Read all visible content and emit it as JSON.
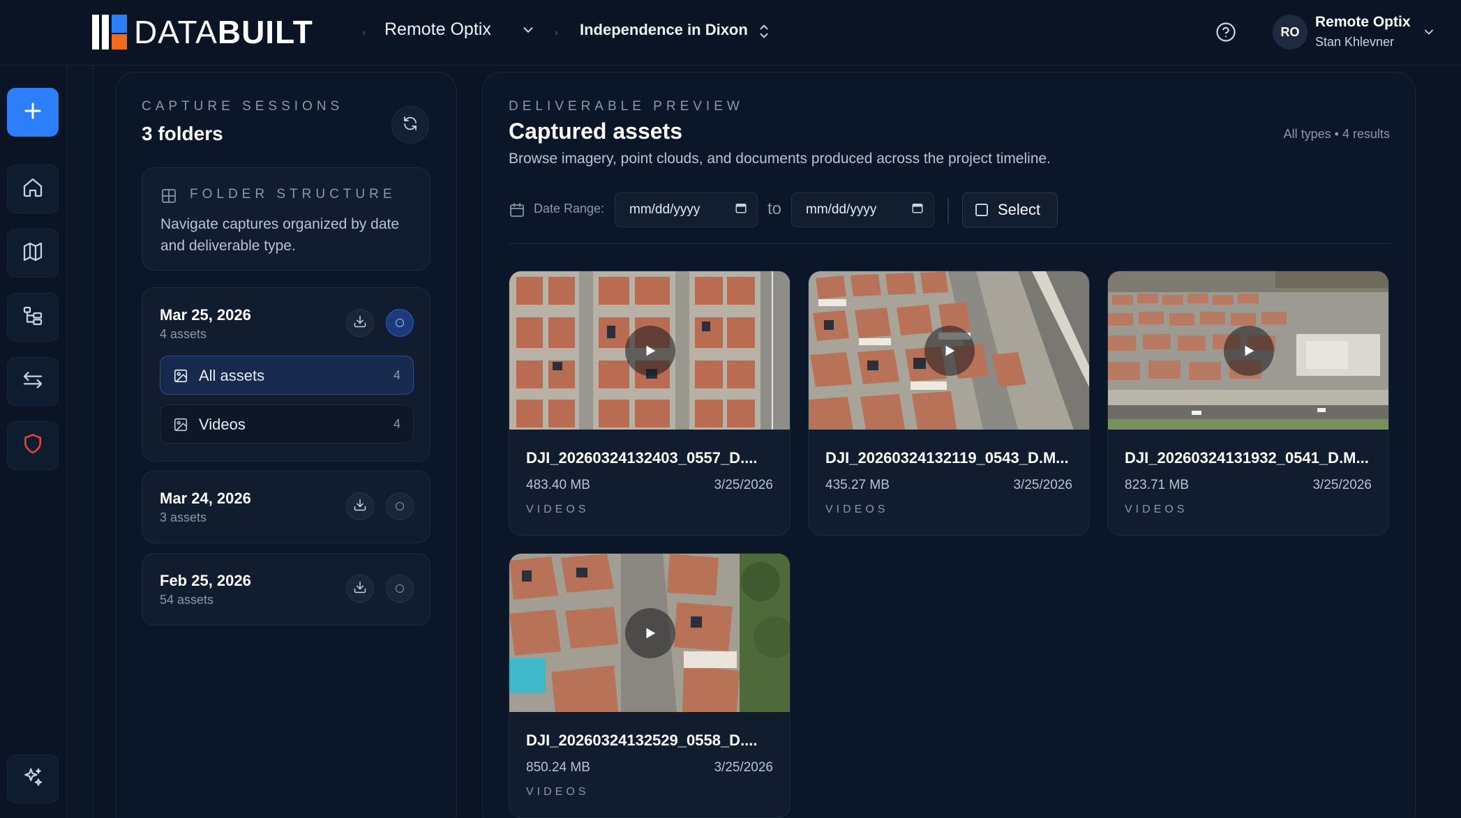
{
  "brand": {
    "name_thin": "DATA",
    "name_bold": "BUILT"
  },
  "breadcrumb": {
    "organization": "Remote Optix",
    "project": "Independence in Dixon"
  },
  "user": {
    "initials": "RO",
    "org_name": "Remote Optix",
    "user_name": "Stan Khlevner"
  },
  "rail": {
    "items": [
      {
        "icon": "plus-icon"
      },
      {
        "icon": "home-icon"
      },
      {
        "icon": "map-icon"
      },
      {
        "icon": "tree-structure-icon"
      },
      {
        "icon": "transfer-arrows-icon"
      },
      {
        "icon": "shield-icon"
      },
      {
        "icon": "sparkles-icon"
      }
    ]
  },
  "capture_sessions": {
    "eyebrow": "CAPTURE SESSIONS",
    "title": "3 folders",
    "folder_structure": {
      "eyebrow": "FOLDER STRUCTURE",
      "description": "Navigate captures organized by date and deliverable type."
    },
    "groups": [
      {
        "date": "Mar 25, 2026",
        "count": "4 assets",
        "selected": true,
        "items": [
          {
            "label": "All assets",
            "count": "4",
            "active": true
          },
          {
            "label": "Videos",
            "count": "4",
            "active": false
          }
        ]
      },
      {
        "date": "Mar 24, 2026",
        "count": "3 assets",
        "selected": false
      },
      {
        "date": "Feb 25, 2026",
        "count": "54 assets",
        "selected": false
      }
    ]
  },
  "preview": {
    "eyebrow": "DELIVERABLE PREVIEW",
    "title": "Captured assets",
    "description": "Browse imagery, point clouds, and documents produced across the project timeline.",
    "results": "All types • 4 results",
    "filters": {
      "date_range_label": "Date Range:",
      "from_placeholder": "mm/dd/yyyy",
      "to_label": "to",
      "to_placeholder": "mm/dd/yyyy",
      "select_label": "Select"
    },
    "assets": [
      {
        "name": "DJI_20260324132403_0557_D....",
        "size": "483.40 MB",
        "date": "3/25/2026",
        "type": "VIDEOS"
      },
      {
        "name": "DJI_20260324132119_0543_D.M...",
        "size": "435.27 MB",
        "date": "3/25/2026",
        "type": "VIDEOS"
      },
      {
        "name": "DJI_20260324131932_0541_D.M...",
        "size": "823.71 MB",
        "date": "3/25/2026",
        "type": "VIDEOS"
      },
      {
        "name": "DJI_20260324132529_0558_D....",
        "size": "850.24 MB",
        "date": "3/25/2026",
        "type": "VIDEOS"
      }
    ]
  },
  "colors": {
    "background": "#0a1424",
    "panel": "#0b1628",
    "accent": "#2d7ff9",
    "brand_orange": "#f26b1d",
    "shield_red": "#e0433a"
  }
}
